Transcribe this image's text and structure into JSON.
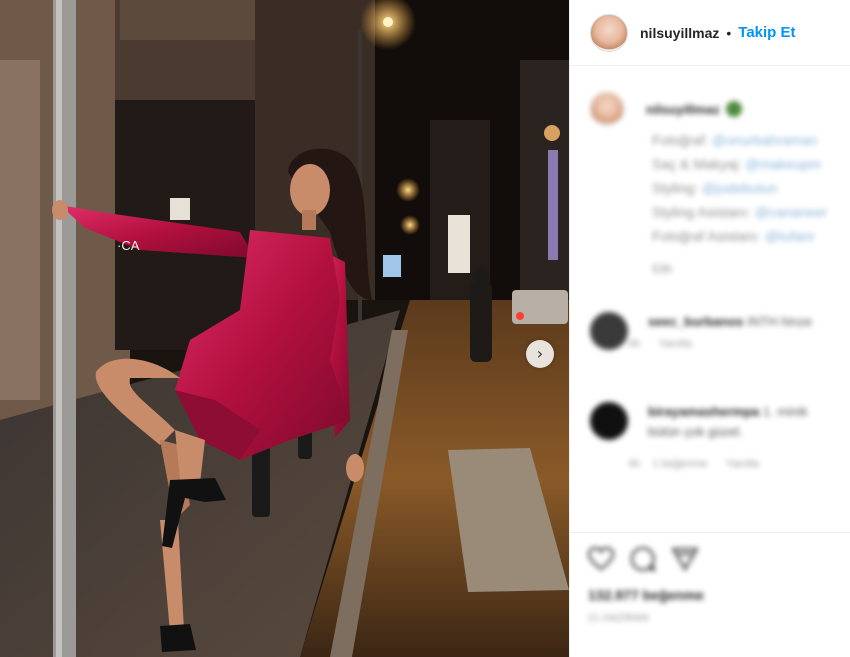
{
  "post": {
    "username": "nilsuyillmaz",
    "separator": "•",
    "follow_label": "Takip Et",
    "next_label": "›"
  },
  "caption": {
    "username": "nilsuyillmaz",
    "lines": [
      {
        "label": "Fotoğraf:",
        "handle": "@onurbahraman"
      },
      {
        "label": "Saç & Makyaj:",
        "handle": "@makeupm"
      },
      {
        "label": "Styling:",
        "handle": "@jodebutun"
      },
      {
        "label": "Styling Asistanı:",
        "handle": "@cananeer"
      },
      {
        "label": "Fotoğraf Asistanı:",
        "handle": "@tufanr"
      }
    ],
    "time": "53h"
  },
  "comments": [
    {
      "username": "seec_burbanos",
      "text": "INTH hinze",
      "time": "4h",
      "reply": "Yanıtla"
    },
    {
      "username": "birayamashermpa",
      "text": "1. minik",
      "line2": "bütün çok güzel.",
      "time": "4h",
      "likes": "1 beğenme",
      "reply": "Yanıtla"
    }
  ],
  "actions": {
    "likes_text": "132.977 beğenme",
    "date_text": "21 HAZİRAN"
  },
  "colors": {
    "link": "#0095f6",
    "dress": "#c0134a",
    "text": "#262626",
    "muted": "#8e8e8e"
  }
}
